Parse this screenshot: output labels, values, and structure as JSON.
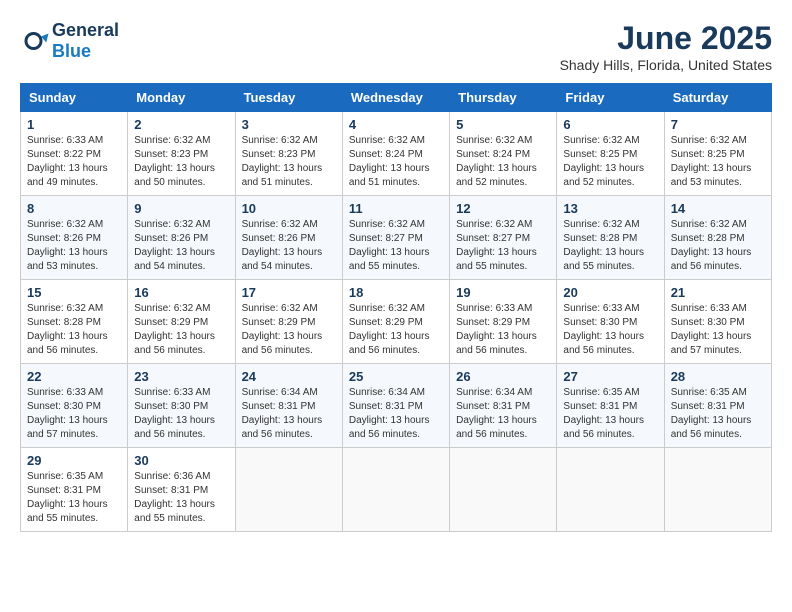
{
  "header": {
    "logo_general": "General",
    "logo_blue": "Blue",
    "month_year": "June 2025",
    "location": "Shady Hills, Florida, United States"
  },
  "days_of_week": [
    "Sunday",
    "Monday",
    "Tuesday",
    "Wednesday",
    "Thursday",
    "Friday",
    "Saturday"
  ],
  "weeks": [
    [
      {
        "day": 1,
        "sunrise": "6:33 AM",
        "sunset": "8:22 PM",
        "daylight": "13 hours and 49 minutes."
      },
      {
        "day": 2,
        "sunrise": "6:32 AM",
        "sunset": "8:23 PM",
        "daylight": "13 hours and 50 minutes."
      },
      {
        "day": 3,
        "sunrise": "6:32 AM",
        "sunset": "8:23 PM",
        "daylight": "13 hours and 51 minutes."
      },
      {
        "day": 4,
        "sunrise": "6:32 AM",
        "sunset": "8:24 PM",
        "daylight": "13 hours and 51 minutes."
      },
      {
        "day": 5,
        "sunrise": "6:32 AM",
        "sunset": "8:24 PM",
        "daylight": "13 hours and 52 minutes."
      },
      {
        "day": 6,
        "sunrise": "6:32 AM",
        "sunset": "8:25 PM",
        "daylight": "13 hours and 52 minutes."
      },
      {
        "day": 7,
        "sunrise": "6:32 AM",
        "sunset": "8:25 PM",
        "daylight": "13 hours and 53 minutes."
      }
    ],
    [
      {
        "day": 8,
        "sunrise": "6:32 AM",
        "sunset": "8:26 PM",
        "daylight": "13 hours and 53 minutes."
      },
      {
        "day": 9,
        "sunrise": "6:32 AM",
        "sunset": "8:26 PM",
        "daylight": "13 hours and 54 minutes."
      },
      {
        "day": 10,
        "sunrise": "6:32 AM",
        "sunset": "8:26 PM",
        "daylight": "13 hours and 54 minutes."
      },
      {
        "day": 11,
        "sunrise": "6:32 AM",
        "sunset": "8:27 PM",
        "daylight": "13 hours and 55 minutes."
      },
      {
        "day": 12,
        "sunrise": "6:32 AM",
        "sunset": "8:27 PM",
        "daylight": "13 hours and 55 minutes."
      },
      {
        "day": 13,
        "sunrise": "6:32 AM",
        "sunset": "8:28 PM",
        "daylight": "13 hours and 55 minutes."
      },
      {
        "day": 14,
        "sunrise": "6:32 AM",
        "sunset": "8:28 PM",
        "daylight": "13 hours and 56 minutes."
      }
    ],
    [
      {
        "day": 15,
        "sunrise": "6:32 AM",
        "sunset": "8:28 PM",
        "daylight": "13 hours and 56 minutes."
      },
      {
        "day": 16,
        "sunrise": "6:32 AM",
        "sunset": "8:29 PM",
        "daylight": "13 hours and 56 minutes."
      },
      {
        "day": 17,
        "sunrise": "6:32 AM",
        "sunset": "8:29 PM",
        "daylight": "13 hours and 56 minutes."
      },
      {
        "day": 18,
        "sunrise": "6:32 AM",
        "sunset": "8:29 PM",
        "daylight": "13 hours and 56 minutes."
      },
      {
        "day": 19,
        "sunrise": "6:33 AM",
        "sunset": "8:29 PM",
        "daylight": "13 hours and 56 minutes."
      },
      {
        "day": 20,
        "sunrise": "6:33 AM",
        "sunset": "8:30 PM",
        "daylight": "13 hours and 56 minutes."
      },
      {
        "day": 21,
        "sunrise": "6:33 AM",
        "sunset": "8:30 PM",
        "daylight": "13 hours and 57 minutes."
      }
    ],
    [
      {
        "day": 22,
        "sunrise": "6:33 AM",
        "sunset": "8:30 PM",
        "daylight": "13 hours and 57 minutes."
      },
      {
        "day": 23,
        "sunrise": "6:33 AM",
        "sunset": "8:30 PM",
        "daylight": "13 hours and 56 minutes."
      },
      {
        "day": 24,
        "sunrise": "6:34 AM",
        "sunset": "8:31 PM",
        "daylight": "13 hours and 56 minutes."
      },
      {
        "day": 25,
        "sunrise": "6:34 AM",
        "sunset": "8:31 PM",
        "daylight": "13 hours and 56 minutes."
      },
      {
        "day": 26,
        "sunrise": "6:34 AM",
        "sunset": "8:31 PM",
        "daylight": "13 hours and 56 minutes."
      },
      {
        "day": 27,
        "sunrise": "6:35 AM",
        "sunset": "8:31 PM",
        "daylight": "13 hours and 56 minutes."
      },
      {
        "day": 28,
        "sunrise": "6:35 AM",
        "sunset": "8:31 PM",
        "daylight": "13 hours and 56 minutes."
      }
    ],
    [
      {
        "day": 29,
        "sunrise": "6:35 AM",
        "sunset": "8:31 PM",
        "daylight": "13 hours and 55 minutes."
      },
      {
        "day": 30,
        "sunrise": "6:36 AM",
        "sunset": "8:31 PM",
        "daylight": "13 hours and 55 minutes."
      },
      null,
      null,
      null,
      null,
      null
    ]
  ]
}
